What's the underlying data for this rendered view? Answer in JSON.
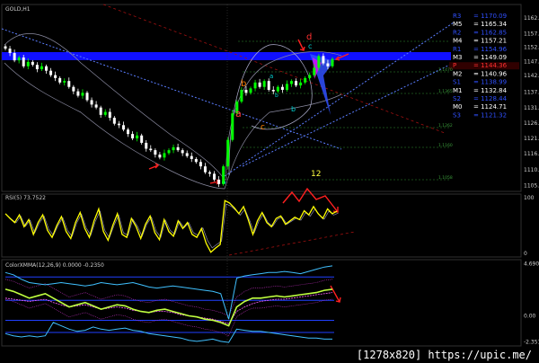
{
  "chart_window": {
    "symbol_label": "GOLD,H1",
    "rsi_label": "RSI(5) 73.7522",
    "macd_label": "ColorXMMA(12,26,9) 0.0000 -0.2350"
  },
  "watermark": "[1278x820] https://upic.me/",
  "colors": {
    "background": "#000000",
    "candle_up": "#00ff00",
    "candle_down": "#ffffff",
    "blue_band": "#1010ff",
    "channel": "#6f8fff",
    "rsi_line": "#ffff00",
    "red_arrow": "#ff2020",
    "wave_orange": "#ff7f00",
    "wave_cyan": "#00d0d0"
  },
  "chart_data": [
    {
      "type": "candlestick",
      "title": "GOLD,H1",
      "price_axis_ticks": [
        "1162.35",
        "1157.10",
        "1152.45",
        "1147.60",
        "1142.85",
        "1137.25",
        "1131.90",
        "1126.70",
        "1121.55",
        "1116.35",
        "1110.80",
        "1105.55"
      ],
      "ylim": [
        1103.5,
        1167.0
      ],
      "close": [
        1152,
        1150.5,
        1148,
        1149,
        1146,
        1147.5,
        1146.5,
        1145,
        1146,
        1144.5,
        1143,
        1142,
        1140.5,
        1141,
        1139,
        1137.5,
        1136,
        1137,
        1134.5,
        1133,
        1132,
        1129.5,
        1130.5,
        1128.5,
        1126.5,
        1126,
        1124.5,
        1123,
        1121.5,
        1122.5,
        1120,
        1118,
        1117.5,
        1116,
        1115,
        1116.5,
        1117.5,
        1118.5,
        1117.5,
        1116.5,
        1115.5,
        1114.5,
        1113.5,
        1112,
        1110,
        1109.5,
        1107.5,
        1106,
        1112,
        1121,
        1130,
        1134,
        1138,
        1137,
        1138.5,
        1140.5,
        1139,
        1141,
        1138,
        1137.5,
        1139,
        1138,
        1140,
        1141,
        1139.5,
        1140.5,
        1142,
        1143,
        1145.5,
        1149.5,
        1147,
        1146,
        1148.5
      ]
    },
    {
      "type": "pivot_levels",
      "levels": [
        {
          "name": "R3",
          "value": "1170.09",
          "color": "#3050ff"
        },
        {
          "name": "M5",
          "value": "1165.34",
          "color": "#ffffff"
        },
        {
          "name": "R2",
          "value": "1162.85",
          "color": "#3050ff"
        },
        {
          "name": "M4",
          "value": "1157.21",
          "color": "#ffffff"
        },
        {
          "name": "R1",
          "value": "1154.96",
          "color": "#3050ff"
        },
        {
          "name": "M3",
          "value": "1149.09",
          "color": "#ffffff"
        },
        {
          "name": "P",
          "value": "1144.36",
          "color": "#ff3030"
        },
        {
          "name": "M2",
          "value": "1140.96",
          "color": "#ffffff"
        },
        {
          "name": "S1",
          "value": "1138.99",
          "color": "#3050ff"
        },
        {
          "name": "M1",
          "value": "1132.84",
          "color": "#ffffff"
        },
        {
          "name": "S2",
          "value": "1128.44",
          "color": "#3050ff"
        },
        {
          "name": "M0",
          "value": "1124.71",
          "color": "#ffffff"
        },
        {
          "name": "S3",
          "value": "1121.32",
          "color": "#3050ff"
        }
      ]
    },
    {
      "type": "line",
      "title": "RSI(5) 73.7522",
      "tick_labels": [
        "100",
        "0"
      ],
      "ylim": [
        0,
        100
      ],
      "values": [
        70,
        62,
        55,
        68,
        48,
        60,
        35,
        55,
        68,
        42,
        30,
        50,
        65,
        40,
        28,
        55,
        72,
        45,
        30,
        58,
        78,
        40,
        25,
        50,
        70,
        35,
        30,
        62,
        48,
        28,
        52,
        66,
        38,
        26,
        60,
        40,
        32,
        58,
        45,
        55,
        35,
        30,
        45,
        20,
        5,
        12,
        18,
        92,
        88,
        80,
        70,
        82,
        60,
        35,
        58,
        72,
        55,
        48,
        62,
        66,
        52,
        58,
        64,
        60,
        75,
        68,
        82,
        70,
        62,
        78,
        70,
        74
      ]
    },
    {
      "type": "line",
      "title": "ColorXMMA(12,26,9) 0.0000 -0.2350",
      "tick_labels": [
        "4.6902",
        "0.00",
        "-2.351"
      ],
      "ylim": [
        -2.55,
        4.9
      ],
      "series_upper": [
        3.9,
        3.7,
        3.3,
        3.0,
        2.9,
        2.8,
        2.9,
        3.0,
        2.9,
        2.8,
        2.7,
        2.8,
        3.0,
        2.9,
        2.8,
        2.9,
        3.0,
        2.8,
        2.6,
        2.5,
        2.6,
        2.7,
        2.6,
        2.5,
        2.4,
        2.3,
        2.2,
        2.0,
        -0.3,
        3.4,
        3.6,
        3.7,
        3.8,
        3.9,
        3.9,
        4.0,
        3.9,
        3.8,
        4.0,
        4.2,
        4.4,
        4.5
      ],
      "series_lower": [
        -1.6,
        -1.8,
        -1.9,
        -1.8,
        -1.9,
        -1.8,
        -0.6,
        -0.9,
        -1.2,
        -1.4,
        -1.3,
        -1.0,
        -1.2,
        -1.3,
        -1.2,
        -1.1,
        -1.3,
        -1.4,
        -1.6,
        -1.7,
        -1.8,
        -1.9,
        -2.0,
        -2.2,
        -2.3,
        -2.2,
        -2.1,
        -2.3,
        -2.4,
        -1.2,
        -1.3,
        -1.4,
        -1.4,
        -1.5,
        -1.6,
        -1.7,
        -1.8,
        -1.9,
        -2.0,
        -2.0,
        -2.1,
        -2.1
      ],
      "series_main": [
        2.4,
        2.2,
        1.9,
        1.6,
        1.8,
        2.0,
        1.6,
        1.2,
        0.8,
        1.0,
        1.2,
        0.9,
        0.6,
        0.8,
        1.0,
        0.9,
        0.6,
        0.4,
        0.3,
        0.5,
        0.6,
        0.4,
        0.2,
        0.0,
        -0.1,
        -0.3,
        -0.4,
        -0.6,
        -0.9,
        0.8,
        1.3,
        1.6,
        1.6,
        1.7,
        1.8,
        1.7,
        1.8,
        1.9,
        2.0,
        2.1,
        2.3,
        2.4
      ],
      "series_signal": [
        1.6,
        1.5,
        1.4,
        1.3,
        1.4,
        1.5,
        1.2,
        1.0,
        0.8,
        0.9,
        1.0,
        0.8,
        0.6,
        0.7,
        0.8,
        0.7,
        0.5,
        0.4,
        0.3,
        0.4,
        0.4,
        0.3,
        0.1,
        0.0,
        -0.1,
        -0.2,
        -0.3,
        -0.5,
        -0.7,
        0.4,
        0.8,
        1.1,
        1.3,
        1.4,
        1.5,
        1.5,
        1.6,
        1.7,
        1.8,
        1.9,
        2.0,
        2.1
      ],
      "levels": [
        3.5,
        1.4,
        -0.4,
        -1.5
      ]
    }
  ],
  "fib_level_labels": [
    "1.1470",
    "1.1365",
    "1.1262",
    "1.1160",
    "1.1058"
  ],
  "wave_labels": [
    {
      "text": "d",
      "color": "#ff3030"
    },
    {
      "text": "c",
      "color": "#00d0d0"
    },
    {
      "text": "b",
      "color": "#ff7f00"
    },
    {
      "text": "a",
      "color": "#ff3030"
    },
    {
      "text": "c",
      "color": "#ff7f00"
    },
    {
      "text": "a",
      "color": "#00d0d0"
    },
    {
      "text": "b",
      "color": "#00d0d0"
    },
    {
      "text": "b",
      "color": "#00d0d0"
    }
  ],
  "count_label": "12"
}
